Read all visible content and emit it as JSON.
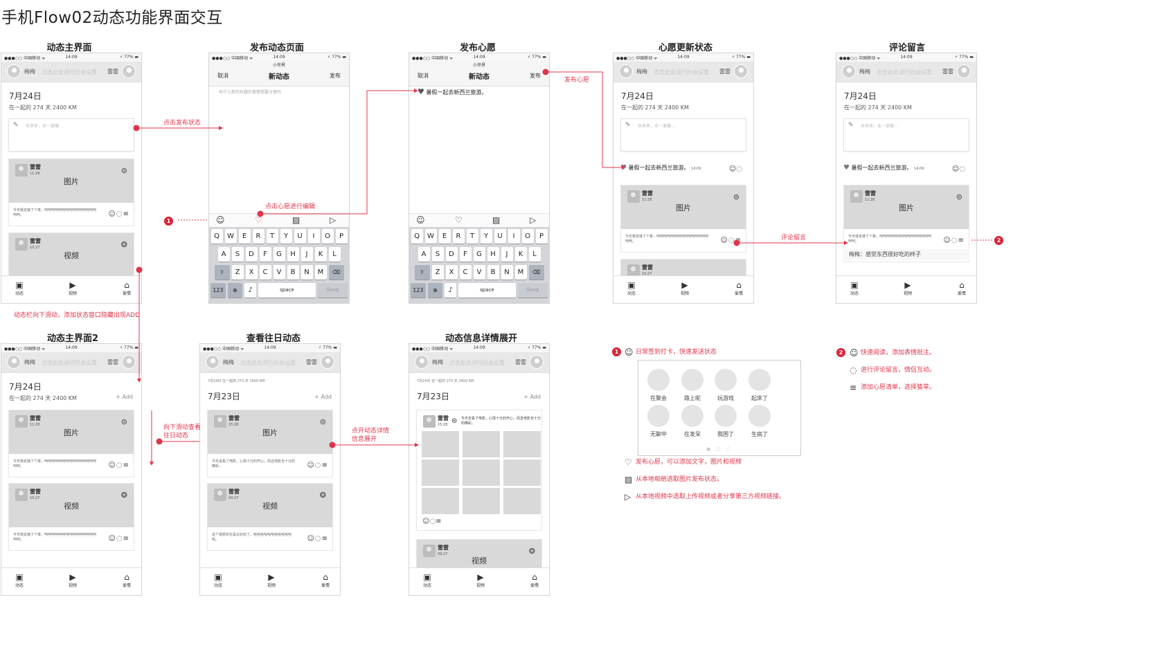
{
  "title": "手机Flow02动态功能界面交互",
  "status_bar": {
    "carrier": "●●●○○ 中国移动 ᯤ",
    "time": "14:09",
    "battery": "⚡ 77% ▬"
  },
  "header": {
    "name1": "梅梅",
    "placeholder": "点击此处进行约会设置",
    "name2": "雷雷"
  },
  "date_main": "7月24日",
  "date_sub": "在一起的 274 天   2400 KM",
  "date_prev": "7月23日",
  "date_prev_small": "7月24日 在一起的 273 天 2400 KM",
  "add_label": "+ Add",
  "status_placeholder": "未来来，未一滚爆...",
  "card_user": "雷雷",
  "card_time1": "11:28",
  "card_time2": "10:27",
  "card_time3": "15:28",
  "card_time4": "09:27",
  "image_label": "图片",
  "video_label": "视频",
  "card_text1": "今天我去接了个章，呵呵呵呵呵呵呵呵呵呵呵呵呵呵呵呵呵。",
  "card_text2": "今天说看了电影，心情十分的开心，而且电影也十分的精彩。",
  "card_text3": "这个视频实在是太好玩了，哈哈哈哈哈哈哈哈哈哈哈哈。",
  "card_text_inline": "今天去看了电影，心情十分的开心，而且电影也十分的精彩。",
  "tabs": [
    "动态",
    "视频",
    "爱情"
  ],
  "nav": {
    "subtitle": "小世界",
    "cancel": "取消",
    "title": "新动态",
    "publish": "发布"
  },
  "compose_placeholder": "有什么新的有趣的事情想要分享吗",
  "wish_text": "暑假一起去新西兰旅游。",
  "wish_time": "14:09",
  "comment_text": "梅梅：感觉东西很好吃的样子",
  "keyboard": {
    "row1": [
      "Q",
      "W",
      "E",
      "R",
      "T",
      "Y",
      "U",
      "I",
      "O",
      "P"
    ],
    "row2": [
      "A",
      "S",
      "D",
      "F",
      "G",
      "H",
      "J",
      "K",
      "L"
    ],
    "row3": [
      "Z",
      "X",
      "C",
      "V",
      "B",
      "N",
      "M"
    ],
    "num": "123",
    "space": "space",
    "send": "Send"
  },
  "sections": {
    "s1": "动态主界面",
    "s2": "发布动态页面",
    "s3": "发布心愿",
    "s4": "心愿更新状态",
    "s5": "评论留言",
    "s6": "动态主界面2",
    "s7": "查看往日动态",
    "s8": "动态信息详情展开"
  },
  "annotations": {
    "click_publish": "点击发布状态",
    "click_wish_edit": "点击心愿进行编辑",
    "publish_wish": "发布心愿",
    "comment": "评论留言",
    "scroll_down": "动态栏向下滑动，添加状态窗口隐藏出现ADD",
    "scroll_view_line1": "向下滑动查看",
    "scroll_view_line2": "往日动态",
    "expand_line1": "点开动态详情",
    "expand_line2": "信息展开"
  },
  "legend1": {
    "badge": "1",
    "title": "日常签到打卡，快速发送状态",
    "moods": [
      "在聚会",
      "路上呢",
      "玩游戏",
      "起床了",
      "无聊中",
      "在发呆",
      "我困了",
      "生病了"
    ],
    "dots": "● ○ ○",
    "items": [
      "发布心愿，可以添加文字，图片和视频",
      "从本地相册选取图片发布状态。",
      "从本地视频中选取上传视频或者分享第三方视频链接。"
    ]
  },
  "legend2": {
    "badge": "2",
    "items": [
      "快速阅读，添加表情批注。",
      "进行评论留言，情侣互动。",
      "添加心愿清单，选择猿草。"
    ]
  },
  "colors": {
    "accent": "#e0344a",
    "badge": "#d9243a",
    "media": "#d9d9d9"
  },
  "icons": {
    "smile": "smile-icon",
    "comment": "comment-icon",
    "list": "list-add-icon",
    "heart": "heart-icon",
    "photo": "photo-icon",
    "video": "video-icon",
    "camera": "camera-icon",
    "pen": "pen-icon"
  }
}
